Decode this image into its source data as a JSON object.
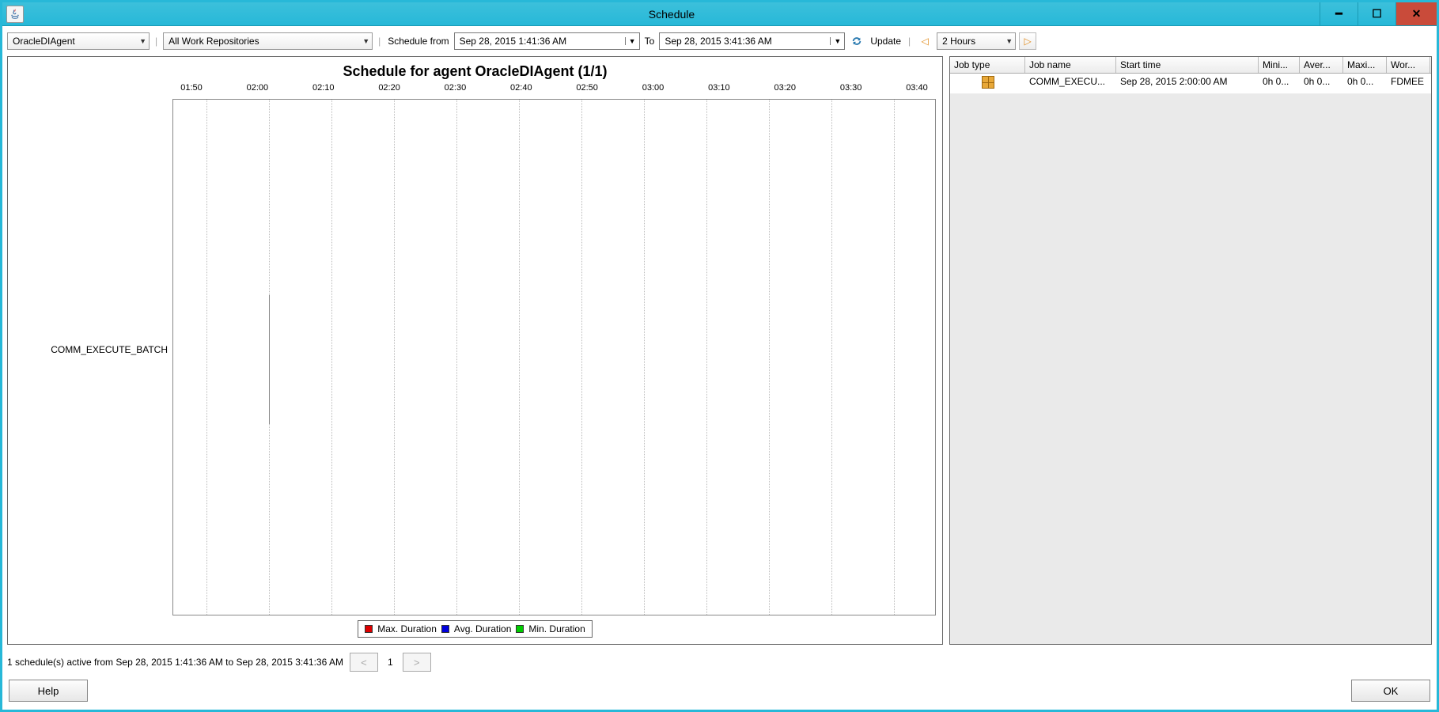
{
  "window": {
    "title": "Schedule"
  },
  "toolbar": {
    "agent": "OracleDIAgent",
    "repo": "All Work Repositories",
    "schedule_from_label": "Schedule from",
    "from_date": "Sep 28, 2015 1:41:36 AM",
    "to_label": "To",
    "to_date": "Sep 28, 2015 3:41:36 AM",
    "update_label": "Update",
    "range": "2 Hours"
  },
  "chart": {
    "title": "Schedule for agent OracleDIAgent (1/1)",
    "y_label": "COMM_EXECUTE_BATCH",
    "legend_max": "Max. Duration",
    "legend_avg": "Avg. Duration",
    "legend_min": "Min. Duration"
  },
  "chart_data": {
    "type": "bar",
    "categories": [
      "01:50",
      "02:00",
      "02:10",
      "02:20",
      "02:30",
      "02:40",
      "02:50",
      "03:00",
      "03:10",
      "03:20",
      "03:30",
      "03:40"
    ],
    "series": [
      {
        "name": "COMM_EXECUTE_BATCH",
        "start": "02:00",
        "duration_min": 0,
        "duration_avg": 0,
        "duration_max": 0
      }
    ],
    "title": "Schedule for agent OracleDIAgent (1/1)",
    "xlabel": "",
    "ylabel": ""
  },
  "table": {
    "headers": {
      "jobtype": "Job type",
      "jobname": "Job name",
      "start": "Start time",
      "mini": "Mini...",
      "aver": "Aver...",
      "maxi": "Maxi...",
      "wor": "Wor..."
    },
    "rows": [
      {
        "jobname": "COMM_EXECU...",
        "start": "Sep 28, 2015 2:00:00 AM",
        "mini": "0h 0...",
        "aver": "0h 0...",
        "maxi": "0h 0...",
        "wor": "FDMEE"
      }
    ]
  },
  "status": {
    "text": "1 schedule(s) active from Sep 28, 2015 1:41:36 AM to Sep 28, 2015 3:41:36 AM",
    "page": "1",
    "prev": "<",
    "next": ">"
  },
  "footer": {
    "help": "Help",
    "ok": "OK"
  }
}
